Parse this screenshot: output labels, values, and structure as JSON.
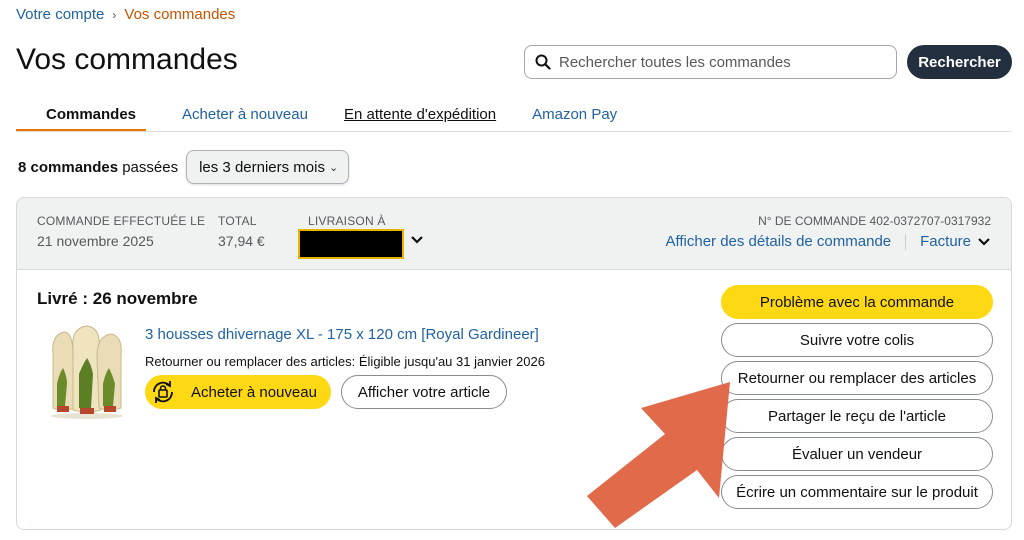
{
  "breadcrumb": {
    "account": "Votre compte",
    "current": "Vos commandes"
  },
  "page_title": "Vos commandes",
  "search": {
    "placeholder": "Rechercher toutes les commandes",
    "button_label": "Rechercher"
  },
  "tabs": [
    {
      "label": "Commandes"
    },
    {
      "label": "Acheter à nouveau"
    },
    {
      "label": "En attente d'expédition"
    },
    {
      "label": "Amazon Pay"
    }
  ],
  "filter": {
    "count": "8 commandes",
    "suffix": " passées",
    "period": "les 3 derniers mois"
  },
  "order": {
    "placed_label": "COMMANDE EFFECTUÉE LE",
    "placed_date": "21 novembre 2025",
    "total_label": "TOTAL",
    "total_value": "37,94 €",
    "ship_label": "LIVRAISON À",
    "number_text": "N° DE COMMANDE 402-0372707-0317932",
    "details_link": "Afficher des détails de commande",
    "invoice_link": "Facture",
    "status": "Livré : 26 novembre",
    "product_title": "3 housses dhivernage XL - 175 x 120 cm [Royal Gardineer]",
    "return_note": "Retourner ou remplacer des articles: Éligible jusqu'au 31 janvier 2026",
    "buy_again": "Acheter à nouveau",
    "view_item": "Afficher votre article"
  },
  "actions": [
    "Problème avec la commande",
    "Suivre votre colis",
    "Retourner ou remplacer des articles",
    "Partager le reçu de l'article",
    "Évaluer un vendeur",
    "Écrire un commentaire sur le produit"
  ],
  "colors": {
    "link": "#2162a1",
    "accent_orange": "#c45500",
    "yellow": "#ffd814",
    "dark": "#232f3e",
    "arrow": "#e06a4a"
  }
}
